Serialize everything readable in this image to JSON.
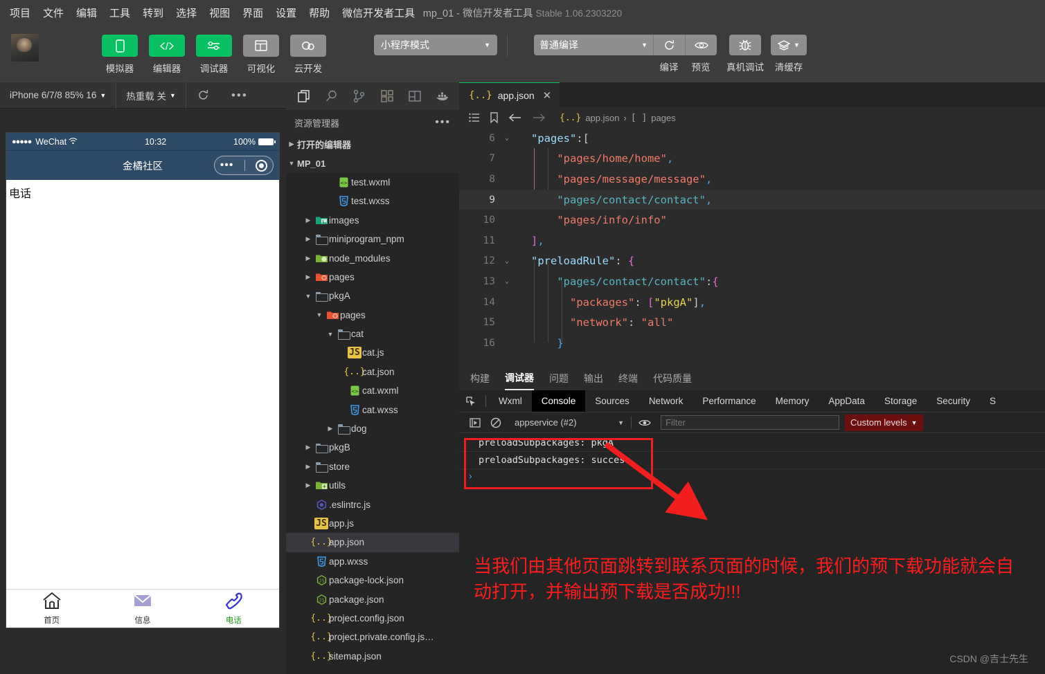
{
  "window": {
    "title_project": "mp_01",
    "title_sep": "-",
    "title_app": "微信开发者工具",
    "title_version": "Stable 1.06.2303220"
  },
  "menubar": {
    "items": [
      "项目",
      "文件",
      "编辑",
      "工具",
      "转到",
      "选择",
      "视图",
      "界面",
      "设置",
      "帮助",
      "微信开发者工具"
    ]
  },
  "toolbar": {
    "buttons": [
      {
        "label": "模拟器",
        "icon": "phone-icon",
        "state": "active"
      },
      {
        "label": "编辑器",
        "icon": "code-icon",
        "state": "active"
      },
      {
        "label": "调试器",
        "icon": "sliders-icon",
        "state": "active"
      },
      {
        "label": "可视化",
        "icon": "layout-icon",
        "state": "inactive"
      },
      {
        "label": "云开发",
        "icon": "cloud-icon",
        "state": "inactive"
      }
    ],
    "mode_select": "小程序模式",
    "compile_select": "普通编译",
    "actions": [
      {
        "label": "编译",
        "icon": "refresh-icon"
      },
      {
        "label": "预览",
        "icon": "eye-icon"
      },
      {
        "label": "真机调试",
        "icon": "bug-icon"
      },
      {
        "label": "清缓存",
        "icon": "layers-icon"
      }
    ],
    "accent_green": "#07c160",
    "button_grey": "#8e8e8e"
  },
  "simulator": {
    "device_select": "iPhone 6/7/8 85% 16",
    "hotreload_select": "热重载 关",
    "refresh_icon": "refresh-icon",
    "more_icon": "ellipsis-icon",
    "status_bar": {
      "carrier": "WeChat",
      "signal_dots": "●●●●●",
      "wifi_icon": "wifi-icon",
      "time": "10:32",
      "battery_percent": "100%"
    },
    "nav_title": "金橘社区",
    "capsule": {
      "more": "•••",
      "close_icon": "target-icon"
    },
    "page_content": "电话",
    "tabbar": [
      {
        "label": "首页",
        "icon": "home-icon",
        "color": "#333333",
        "active": false
      },
      {
        "label": "信息",
        "icon": "mail-icon",
        "color": "#333333",
        "active": false
      },
      {
        "label": "电话",
        "icon": "phone-call-icon",
        "color": "#20a020",
        "active": true
      }
    ],
    "header_color": "#2d4a66"
  },
  "explorer": {
    "activity_icons": [
      "files-icon",
      "search-icon",
      "source-control-icon",
      "extensions-icon",
      "split-editor-icon",
      "docker-icon"
    ],
    "title": "资源管理器",
    "more_icon": "ellipsis-icon",
    "sections": [
      {
        "label": "打开的编辑器",
        "expanded": false
      },
      {
        "label": "MP_01",
        "expanded": true
      }
    ],
    "tree": [
      {
        "label": "test.wxml",
        "indent": 3,
        "type": "file",
        "icon": "wxml-icon",
        "arrow": "none"
      },
      {
        "label": "test.wxss",
        "indent": 3,
        "type": "file",
        "icon": "wxss-icon",
        "arrow": "none"
      },
      {
        "label": "images",
        "indent": 1,
        "type": "folder",
        "icon": "folder-images-icon",
        "arrow": "collapsed"
      },
      {
        "label": "miniprogram_npm",
        "indent": 1,
        "type": "folder",
        "icon": "folder-icon",
        "arrow": "collapsed"
      },
      {
        "label": "node_modules",
        "indent": 1,
        "type": "folder",
        "icon": "folder-node-icon",
        "arrow": "collapsed"
      },
      {
        "label": "pages",
        "indent": 1,
        "type": "folder",
        "icon": "folder-pages-icon",
        "arrow": "collapsed"
      },
      {
        "label": "pkgA",
        "indent": 1,
        "type": "folder",
        "icon": "folder-open-icon",
        "arrow": "expanded"
      },
      {
        "label": "pages",
        "indent": 2,
        "type": "folder",
        "icon": "folder-pages-icon",
        "arrow": "expanded"
      },
      {
        "label": "cat",
        "indent": 3,
        "type": "folder",
        "icon": "folder-open-icon",
        "arrow": "expanded"
      },
      {
        "label": "cat.js",
        "indent": 4,
        "type": "file",
        "icon": "js-icon",
        "arrow": "none"
      },
      {
        "label": "cat.json",
        "indent": 4,
        "type": "file",
        "icon": "json-icon",
        "arrow": "none"
      },
      {
        "label": "cat.wxml",
        "indent": 4,
        "type": "file",
        "icon": "wxml-icon",
        "arrow": "none"
      },
      {
        "label": "cat.wxss",
        "indent": 4,
        "type": "file",
        "icon": "wxss-icon",
        "arrow": "none"
      },
      {
        "label": "dog",
        "indent": 3,
        "type": "folder",
        "icon": "folder-icon",
        "arrow": "collapsed"
      },
      {
        "label": "pkgB",
        "indent": 1,
        "type": "folder",
        "icon": "folder-icon",
        "arrow": "collapsed"
      },
      {
        "label": "store",
        "indent": 1,
        "type": "folder",
        "icon": "folder-icon",
        "arrow": "collapsed"
      },
      {
        "label": "utils",
        "indent": 1,
        "type": "folder",
        "icon": "folder-utils-icon",
        "arrow": "collapsed"
      },
      {
        "label": ".eslintrc.js",
        "indent": 1,
        "type": "file",
        "icon": "eslint-icon",
        "arrow": "none"
      },
      {
        "label": "app.js",
        "indent": 1,
        "type": "file",
        "icon": "js-icon",
        "arrow": "none"
      },
      {
        "label": "app.json",
        "indent": 1,
        "type": "file",
        "icon": "json-icon",
        "arrow": "none",
        "selected": true
      },
      {
        "label": "app.wxss",
        "indent": 1,
        "type": "file",
        "icon": "wxss-icon",
        "arrow": "none"
      },
      {
        "label": "package-lock.json",
        "indent": 1,
        "type": "file",
        "icon": "npm-icon",
        "arrow": "none"
      },
      {
        "label": "package.json",
        "indent": 1,
        "type": "file",
        "icon": "npm-icon",
        "arrow": "none"
      },
      {
        "label": "project.config.json",
        "indent": 1,
        "type": "file",
        "icon": "json-icon",
        "arrow": "none"
      },
      {
        "label": "project.private.config.js…",
        "indent": 1,
        "type": "file",
        "icon": "json-icon",
        "arrow": "none"
      },
      {
        "label": "sitemap.json",
        "indent": 1,
        "type": "file",
        "icon": "json-icon",
        "arrow": "none"
      }
    ]
  },
  "editor": {
    "tab": {
      "label": "app.json",
      "icon": "json-icon",
      "close_icon": "close-icon"
    },
    "breadcrumb_icons": [
      "outline-icon",
      "bookmark-icon",
      "back-arrow-icon",
      "forward-arrow-icon"
    ],
    "breadcrumb": {
      "file_icon": "json-icon",
      "file": "app.json",
      "sep": "›",
      "array_icon": "[ ]",
      "node": "pages"
    },
    "lines": [
      {
        "num": "6",
        "fold": "expanded",
        "current": false
      },
      {
        "num": "7",
        "fold": "",
        "current": false
      },
      {
        "num": "8",
        "fold": "",
        "current": false
      },
      {
        "num": "9",
        "fold": "",
        "current": true
      },
      {
        "num": "10",
        "fold": "",
        "current": false
      },
      {
        "num": "11",
        "fold": "",
        "current": false
      },
      {
        "num": "12",
        "fold": "expanded",
        "current": false
      },
      {
        "num": "13",
        "fold": "expanded",
        "current": false
      },
      {
        "num": "14",
        "fold": "",
        "current": false
      },
      {
        "num": "15",
        "fold": "",
        "current": false
      },
      {
        "num": "16",
        "fold": "",
        "current": false
      }
    ],
    "code_text": [
      "\"pages\":[",
      "    \"pages/home/home\",",
      "    \"pages/message/message\",",
      "    \"pages/contact/contact\",",
      "    \"pages/info/info\"",
      "],",
      "\"preloadRule\": {",
      "    \"pages/contact/contact\":{",
      "      \"packages\": [\"pkgA\"],",
      "      \"network\": \"all\"",
      "    }"
    ]
  },
  "devtools": {
    "panel_tabs": [
      {
        "label": "构建",
        "active": false
      },
      {
        "label": "调试器",
        "active": true
      },
      {
        "label": "问题",
        "active": false
      },
      {
        "label": "输出",
        "active": false
      },
      {
        "label": "终端",
        "active": false
      },
      {
        "label": "代码质量",
        "active": false
      }
    ],
    "inspect_icon": "inspect-icon",
    "devtool_tabs": [
      {
        "label": "Wxml",
        "active": false
      },
      {
        "label": "Console",
        "active": true
      },
      {
        "label": "Sources",
        "active": false
      },
      {
        "label": "Network",
        "active": false
      },
      {
        "label": "Performance",
        "active": false
      },
      {
        "label": "Memory",
        "active": false
      },
      {
        "label": "AppData",
        "active": false
      },
      {
        "label": "Storage",
        "active": false
      },
      {
        "label": "Security",
        "active": false
      },
      {
        "label": "S",
        "active": false
      }
    ],
    "console_bar": {
      "execute_icon": "execute-icon",
      "clear_icon": "clear-icon",
      "context": "appservice (#2)",
      "eye_icon": "eye-icon",
      "filter_placeholder": "Filter",
      "filter_value": "",
      "levels": "Custom levels",
      "levels_color": "#6b0f0f"
    },
    "logs": [
      "preloadSubpackages: pkgA",
      "preloadSubpackages: success"
    ],
    "prompt": "›"
  },
  "annotation": {
    "text": "当我们由其他页面跳转到联系页面的时候，我们的预下载功能就会自动打开，并输出预下载是否成功!!!",
    "color": "#fd1c1c",
    "highlight_box_color": "#f21d1d",
    "arrow_color": "#f21d1d"
  },
  "watermark": "CSDN @吉士先生"
}
